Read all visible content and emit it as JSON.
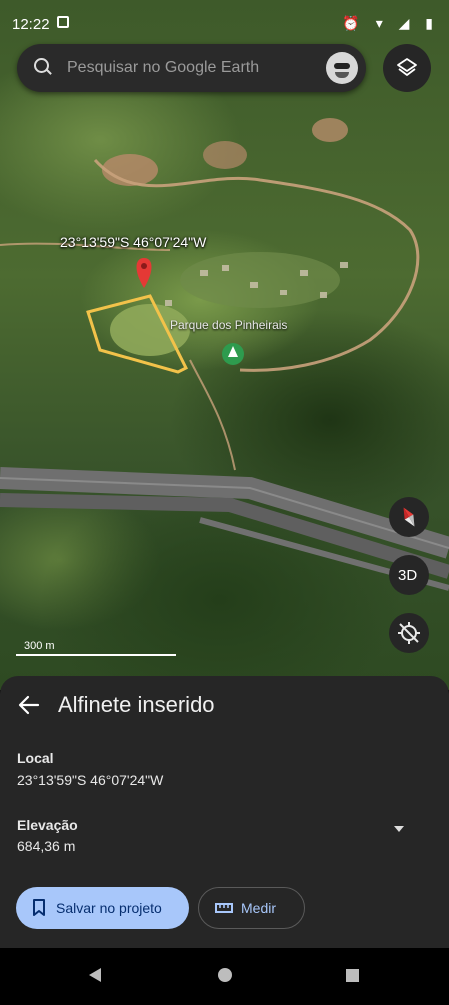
{
  "status_bar": {
    "time": "12:22",
    "icons": "⏰ ▾ ◢ ▮"
  },
  "search": {
    "placeholder": "Pesquisar no Google Earth"
  },
  "map": {
    "pin_coordinates": "23°13'59\"S 46°07'24\"W",
    "place_label": "Parque dos Pinheirais",
    "scale_label": "300 m",
    "button_3d": "3D"
  },
  "sheet": {
    "title": "Alfinete inserido",
    "local_label": "Local",
    "local_value": "23°13'59\"S 46°07'24\"W",
    "elevation_label": "Elevação",
    "elevation_value": "684,36 m",
    "save_button": "Salvar no projeto",
    "measure_button": "Medir"
  },
  "colors": {
    "accent": "#a8c7fa",
    "sheet_bg": "#262626",
    "pin": "#e53935",
    "boundary": "#f2c24a"
  }
}
